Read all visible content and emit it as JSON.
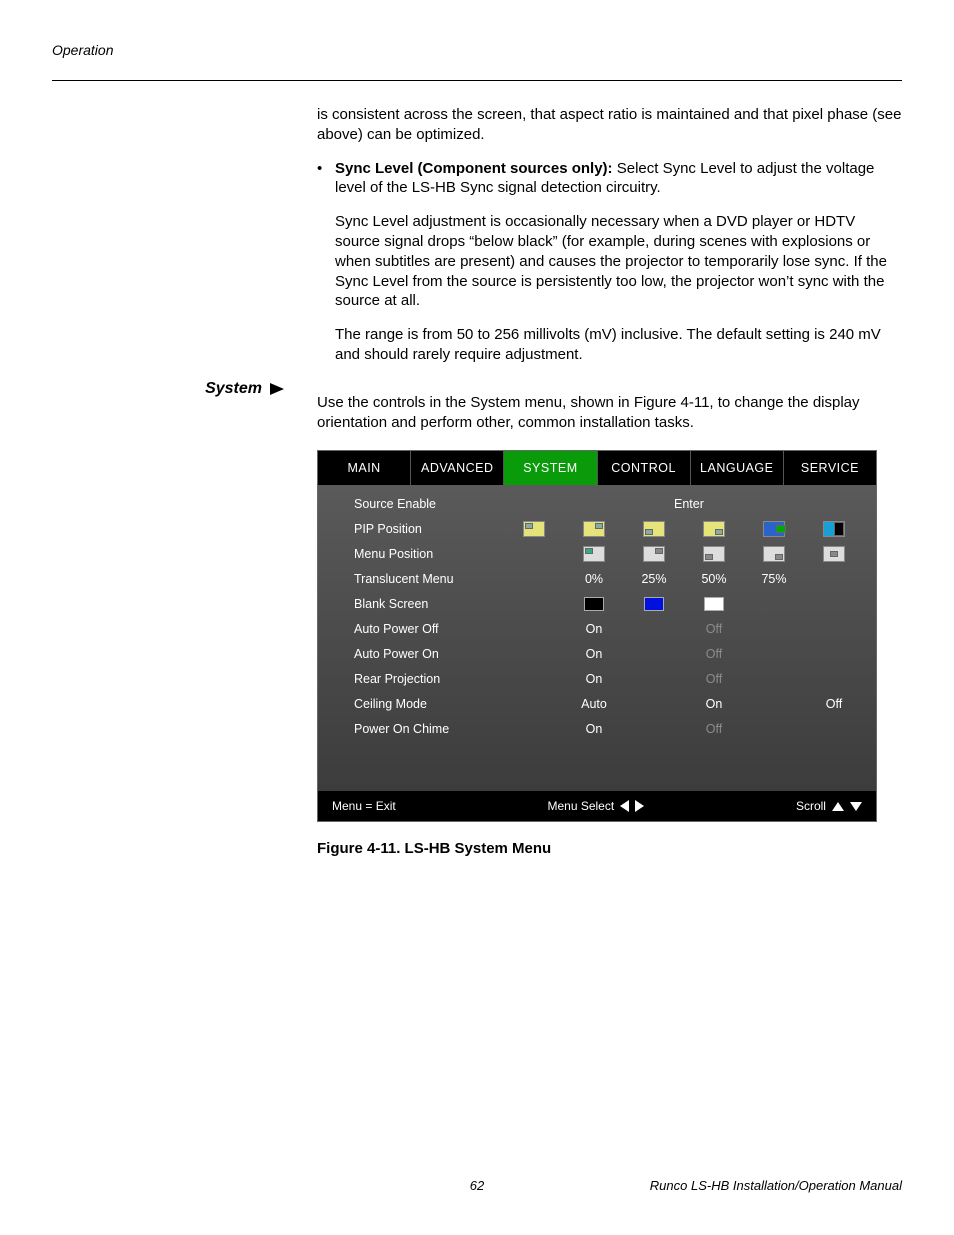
{
  "header": {
    "section": "Operation"
  },
  "body": {
    "intro_cont": "is consistent across the screen, that aspect ratio is maintained and that pixel phase (see above) can be optimized.",
    "sync_bold": "Sync Level (Component sources only):",
    "sync_rest": " Select Sync Level to adjust the voltage level of the LS-HB Sync signal detection circuitry.",
    "sync_p2": "Sync Level adjustment is occasionally necessary when a DVD player or HDTV source signal drops “below black” (for example, during scenes with explosions or when subtitles are present) and causes the projector to temporarily lose sync. If the Sync Level from the source is persistently too low, the projector won’t sync with the source at all.",
    "sync_p3": "The range is from 50 to 256 millivolts (mV) inclusive. The default setting is 240 mV and should rarely require adjustment.",
    "system_heading": "System",
    "system_p": "Use the controls in the System menu, shown in Figure 4-11, to change the display orientation and perform other, common installation tasks."
  },
  "osd": {
    "tabs": [
      "MAIN",
      "ADVANCED",
      "SYSTEM",
      "CONTROL",
      "LANGUAGE",
      "SERVICE"
    ],
    "active_tab": "SYSTEM",
    "rows": {
      "source_enable": {
        "label": "Source Enable",
        "value": "Enter"
      },
      "pip_position": {
        "label": "PIP Position"
      },
      "menu_position": {
        "label": "Menu Position"
      },
      "translucent": {
        "label": "Translucent Menu",
        "opts": [
          "0%",
          "25%",
          "50%",
          "75%"
        ]
      },
      "blank_screen": {
        "label": "Blank Screen"
      },
      "auto_off": {
        "label": "Auto Power Off",
        "opts": [
          "On",
          "Off"
        ],
        "selected": "Off"
      },
      "auto_on": {
        "label": "Auto Power On",
        "opts": [
          "On",
          "Off"
        ],
        "selected": "Off"
      },
      "rear_proj": {
        "label": "Rear Projection",
        "opts": [
          "On",
          "Off"
        ],
        "selected": "Off"
      },
      "ceiling": {
        "label": "Ceiling Mode",
        "opts": [
          "Auto",
          "On",
          "Off"
        ]
      },
      "chime": {
        "label": "Power On Chime",
        "opts": [
          "On",
          "Off"
        ],
        "selected": "Off"
      }
    },
    "footer": {
      "exit": "Menu = Exit",
      "select": "Menu Select",
      "scroll": "Scroll"
    }
  },
  "figure_caption": "Figure 4-11. LS-HB System Menu",
  "footer": {
    "page": "62",
    "right": "Runco LS-HB Installation/Operation Manual"
  }
}
